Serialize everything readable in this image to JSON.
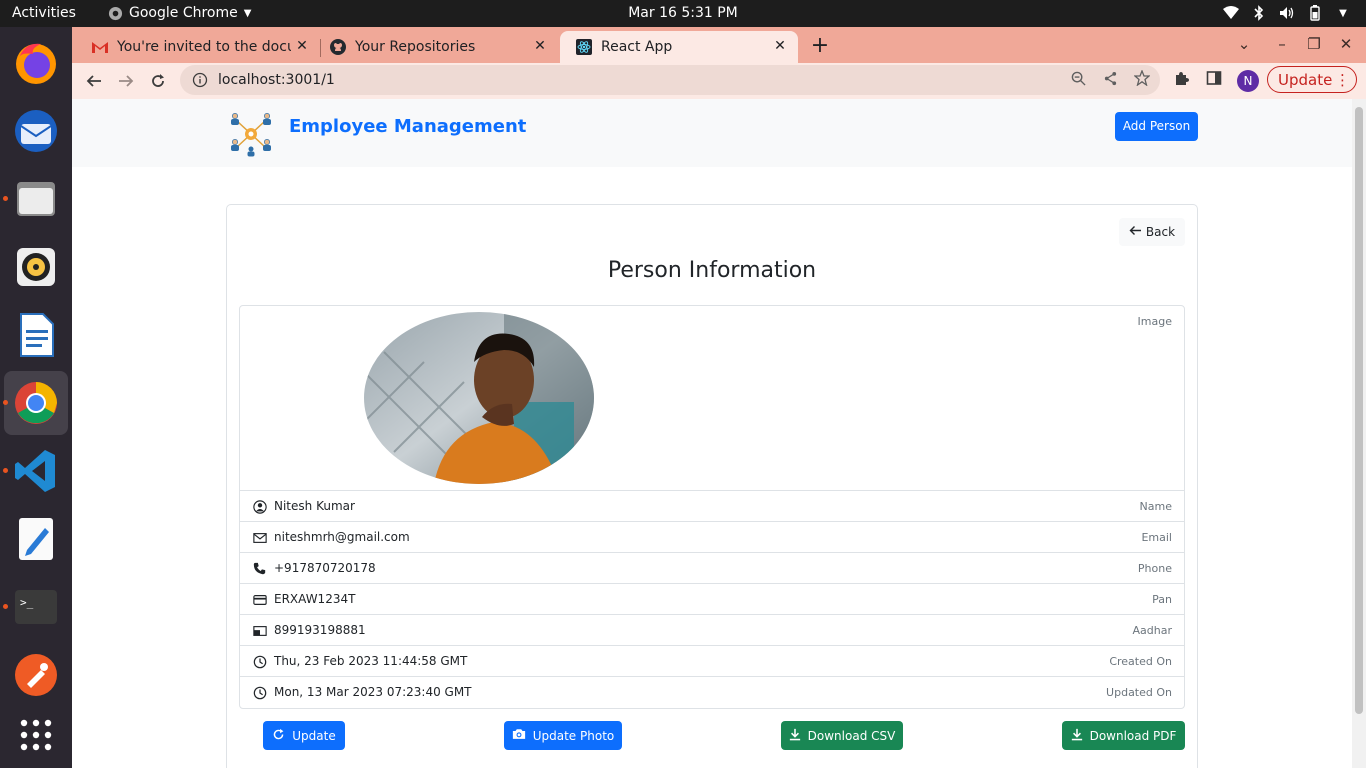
{
  "topbar": {
    "activities": "Activities",
    "app_name": "Google Chrome",
    "clock": "Mar 16  5:31 PM"
  },
  "dock": {
    "apps": [
      "firefox-icon",
      "thunderbird-icon",
      "files-icon",
      "rhythmbox-icon",
      "libreoffice-writer-icon",
      "chrome-icon",
      "vscode-icon",
      "text-editor-icon",
      "terminal-icon",
      "postman-icon",
      "show-apps-icon"
    ]
  },
  "browser": {
    "tabs": [
      {
        "label": "You're invited to the docu",
        "icon": "gmail-icon"
      },
      {
        "label": "Your Repositories",
        "icon": "github-icon"
      },
      {
        "label": "React App",
        "icon": "react-icon"
      }
    ],
    "close_glyph": "✕",
    "new_tab_glyph": "+",
    "url": "localhost:3001/1",
    "profile_initial": "N",
    "update_label": "Update",
    "accent": "#c5221f"
  },
  "app": {
    "brand": "Employee Management",
    "add_person": "Add Person",
    "back": "Back",
    "title": "Person Information",
    "image_label": "Image",
    "fields": [
      {
        "icon": "person-circle-icon",
        "value": "Nitesh Kumar",
        "label": "Name"
      },
      {
        "icon": "envelope-icon",
        "value": "niteshmrh@gmail.com",
        "label": "Email"
      },
      {
        "icon": "phone-icon",
        "value": "+917870720178",
        "label": "Phone"
      },
      {
        "icon": "credit-card-icon",
        "value": "ERXAW1234T",
        "label": "Pan"
      },
      {
        "icon": "id-card-icon",
        "value": "899193198881",
        "label": "Aadhar"
      },
      {
        "icon": "clock-icon",
        "value": "Thu, 23 Feb 2023 11:44:58 GMT",
        "label": "Created On"
      },
      {
        "icon": "clock-icon",
        "value": "Mon, 13 Mar 2023 07:23:40 GMT",
        "label": "Updated On"
      }
    ],
    "buttons": {
      "update": "Update",
      "update_photo": "Update Photo",
      "download_csv": "Download CSV",
      "download_pdf": "Download PDF"
    },
    "colors": {
      "primary": "#0d6efd",
      "success": "#198754"
    }
  }
}
